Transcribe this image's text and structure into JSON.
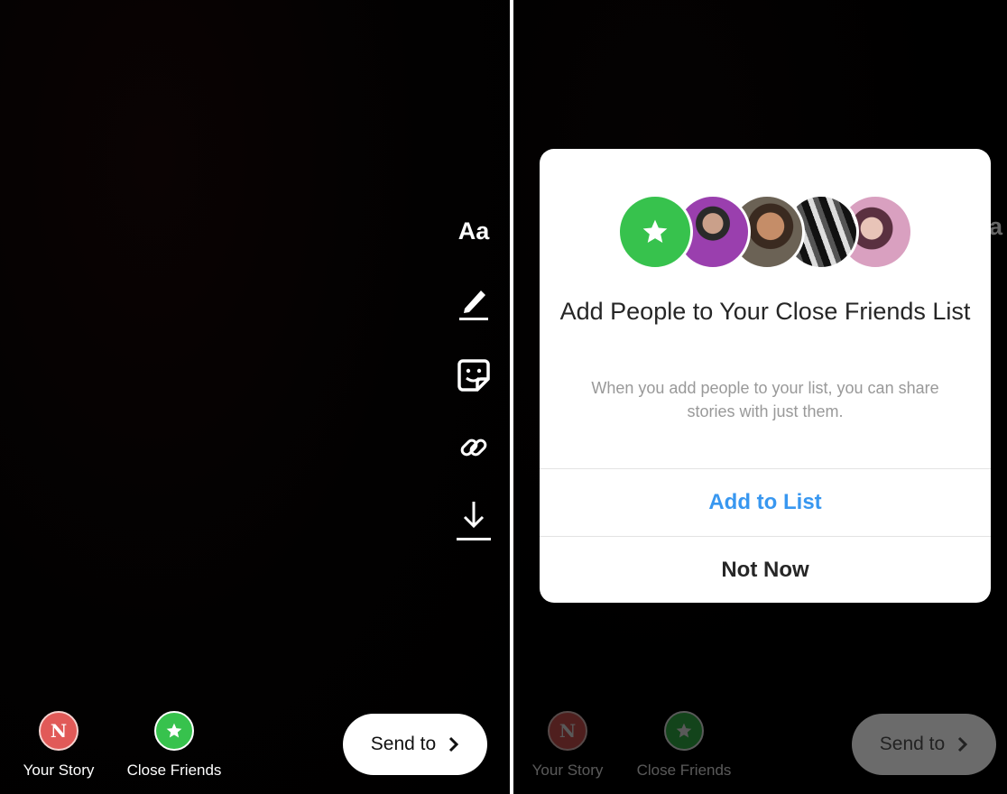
{
  "left_panel": {
    "tools": {
      "text_tool_label": "Aa"
    },
    "share_targets": {
      "your_story_label": "Your Story",
      "close_friends_label": "Close Friends"
    },
    "send_button_label": "Send to"
  },
  "right_panel": {
    "share_targets": {
      "your_story_label": "Your Story",
      "close_friends_label": "Close Friends"
    },
    "send_button_label": "Send to",
    "rail_peek_label": "a",
    "modal": {
      "title": "Add People to Your Close Friends List",
      "subtitle": "When you add people to your list, you can share stories with just them.",
      "primary_button": "Add to List",
      "secondary_button": "Not Now"
    }
  },
  "colors": {
    "accent_blue": "#3897f0",
    "close_friends_green": "#37c24d",
    "story_red": "#e15a58"
  },
  "icons": [
    "pen-icon",
    "sticker-icon",
    "link-icon",
    "download-icon",
    "star-icon",
    "chevron-right-icon"
  ]
}
